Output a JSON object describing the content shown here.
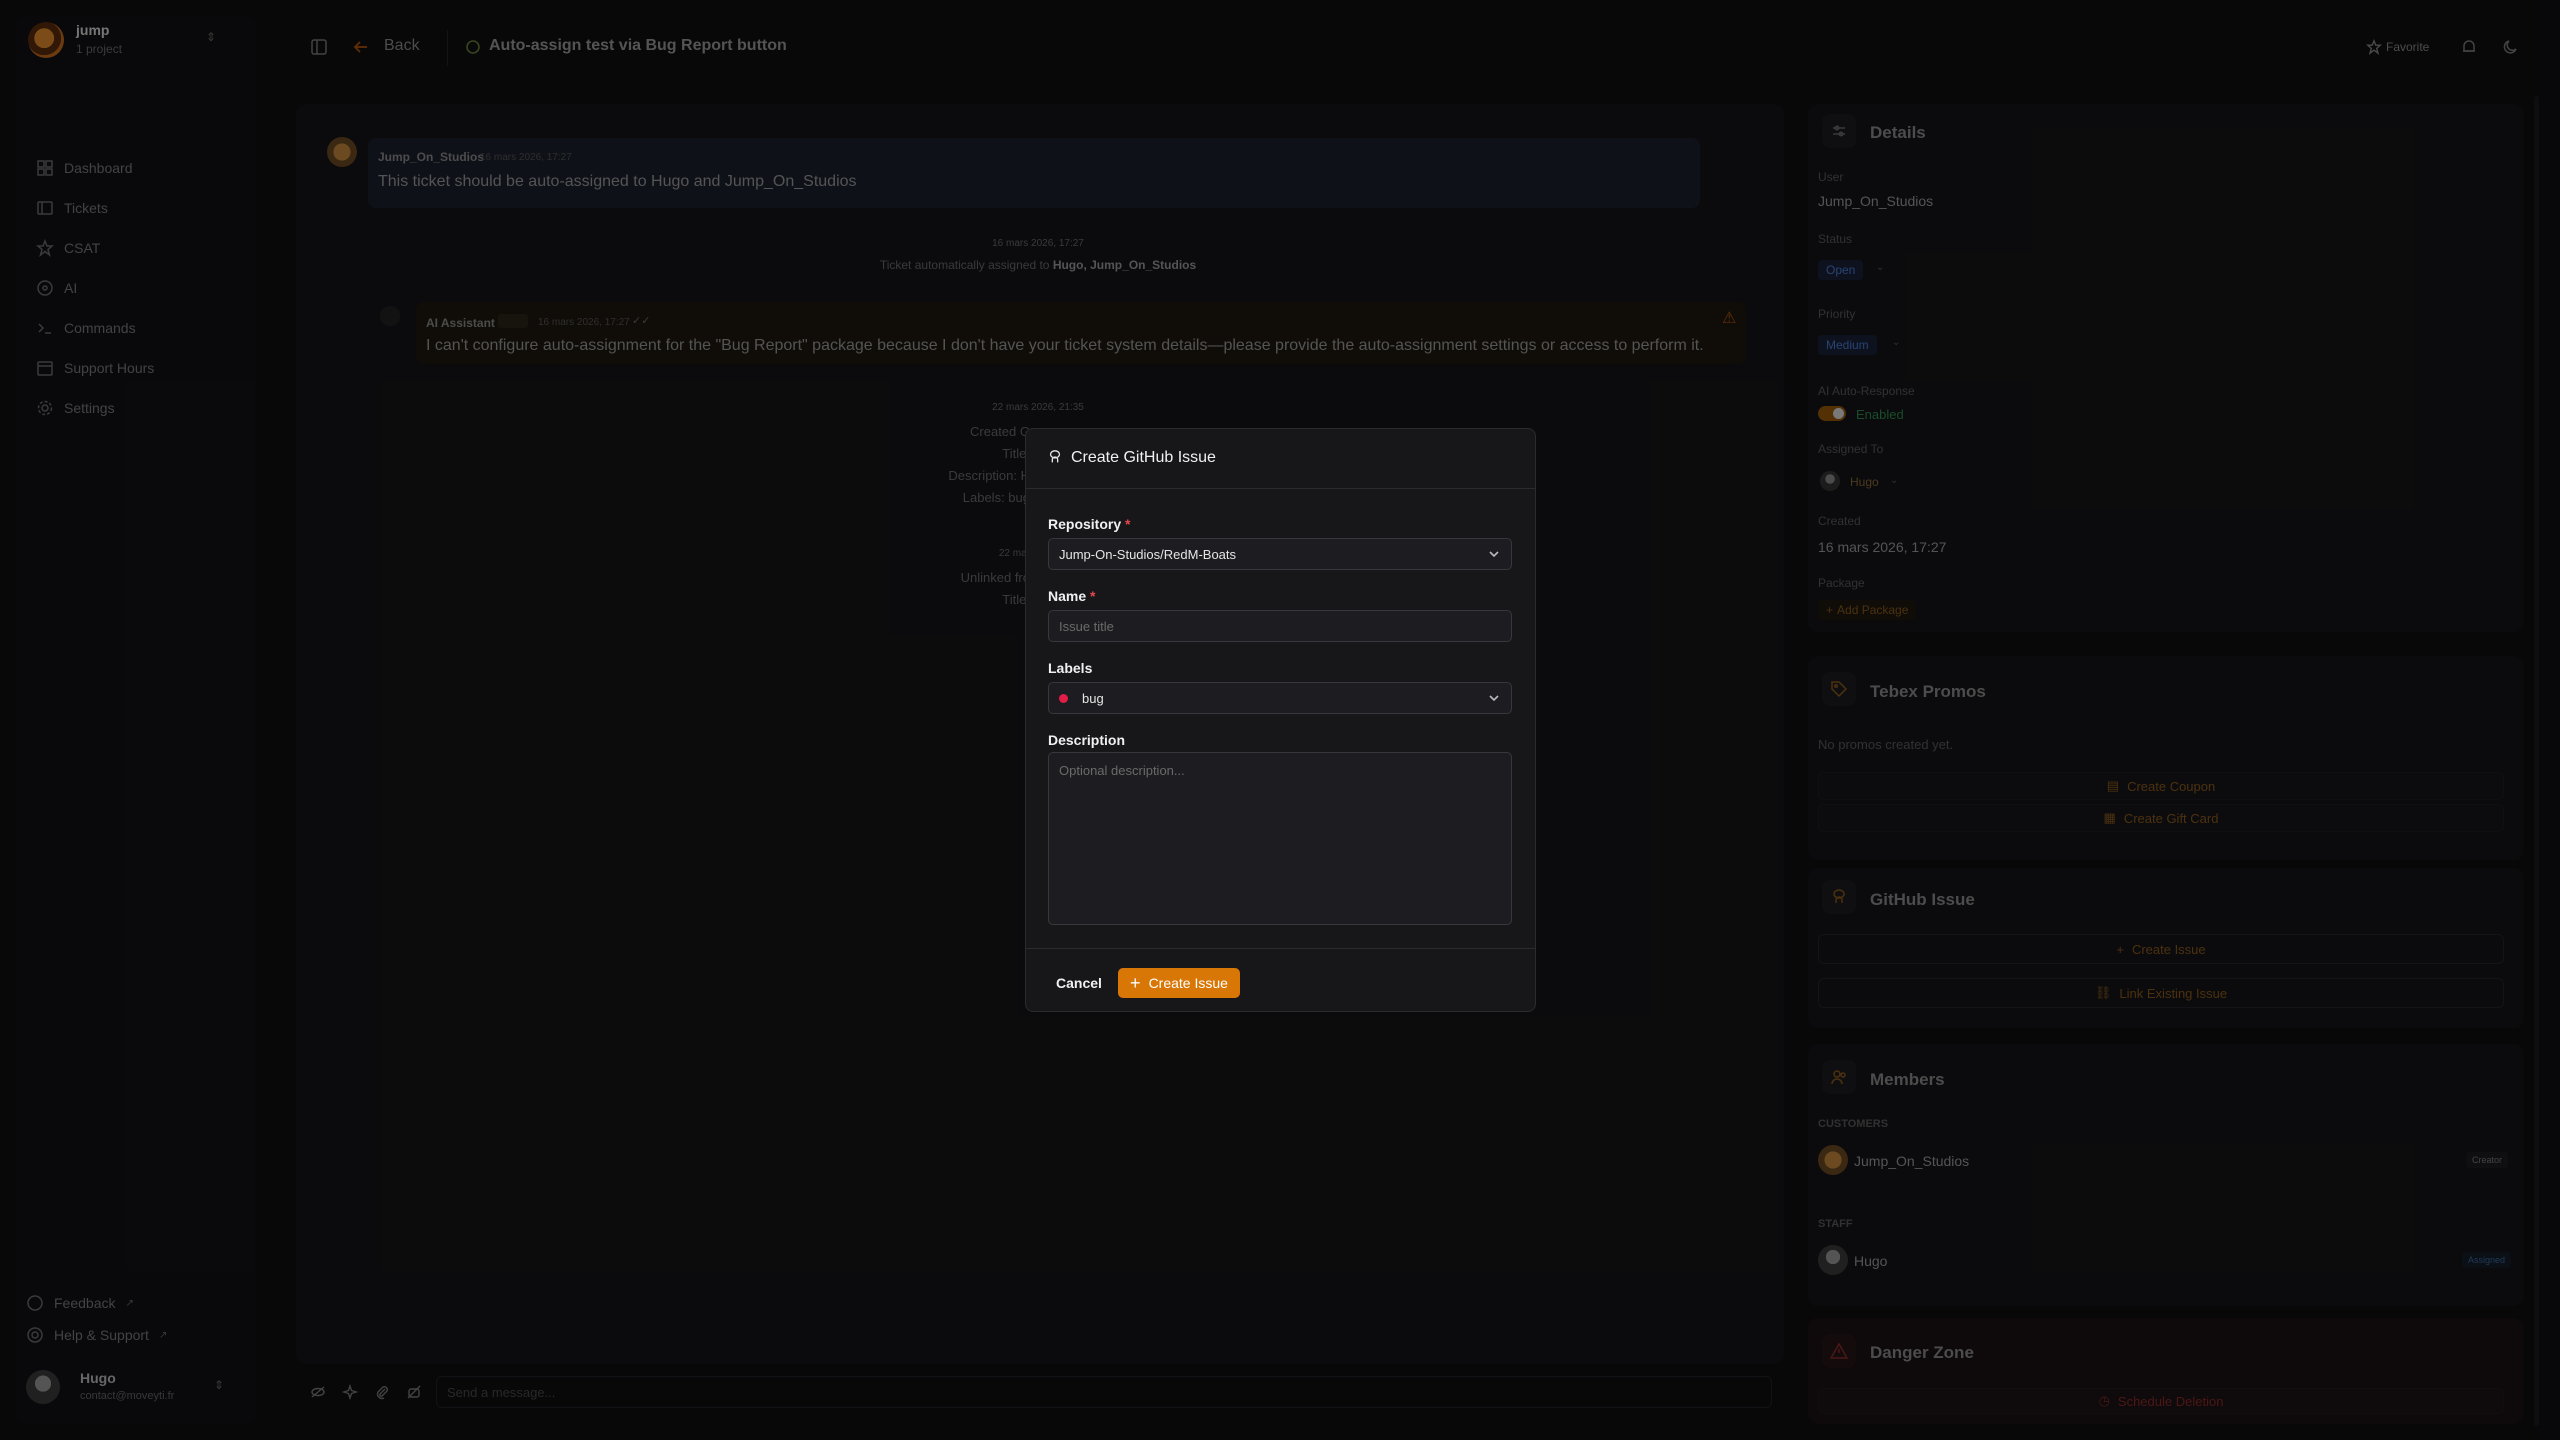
{
  "workspace": {
    "name": "jump",
    "subtitle": "1 project"
  },
  "nav": {
    "items": [
      {
        "label": "Dashboard"
      },
      {
        "label": "Tickets"
      },
      {
        "label": "CSAT"
      },
      {
        "label": "AI"
      },
      {
        "label": "Commands"
      },
      {
        "label": "Support Hours"
      },
      {
        "label": "Settings"
      }
    ]
  },
  "sidebar_footer": {
    "feedback": "Feedback",
    "help": "Help & Support",
    "user_name": "Hugo",
    "user_email": "contact@moveyti.fr"
  },
  "topbar": {
    "back": "Back",
    "ticket_title": "Auto-assign test via Bug Report button",
    "favorite": "Favorite"
  },
  "chat": {
    "msg1": {
      "author": "Jump_On_Studios",
      "time": "16 mars 2026, 17:27",
      "text": "This ticket should be auto-assigned to Hugo and Jump_On_Studios"
    },
    "event1": {
      "time": "16 mars 2026, 17:27",
      "text": "Ticket automatically assigned to",
      "names": "Hugo, Jump_On_Studios"
    },
    "ai": {
      "author": "AI Assistant",
      "time": "16 mars 2026, 17:27",
      "text": "I can't configure auto-assignment for the \"Bug Report\" package because I don't have your ticket system details—please provide the auto-assignment settings or access to perform it."
    },
    "event2": {
      "time": "22 mars 2026, 21:35",
      "l1": "Created G",
      "l2": "Title:",
      "l3": "Description: H",
      "l4": "Labels: bug"
    },
    "event3": {
      "time": "22 mar",
      "l1": "Unlinked fro",
      "l2": "Title:"
    },
    "composer_placeholder": "Send a message..."
  },
  "details": {
    "title": "Details",
    "user_label": "User",
    "user_value": "Jump_On_Studios",
    "status_label": "Status",
    "status_value": "Open",
    "priority_label": "Priority",
    "priority_value": "Medium",
    "ai_label": "AI Auto-Response",
    "ai_value": "Enabled",
    "assigned_label": "Assigned To",
    "assigned_value": "Hugo",
    "created_label": "Created",
    "created_value": "16 mars 2026, 17:27",
    "package_label": "Package",
    "package_add": "Add Package"
  },
  "tebex": {
    "title": "Tebex Promos",
    "empty": "No promos created yet.",
    "coupon": "Create Coupon",
    "giftcard": "Create Gift Card"
  },
  "github": {
    "title": "GitHub Issue",
    "create": "Create Issue",
    "link": "Link Existing Issue"
  },
  "members": {
    "title": "Members",
    "customers_label": "CUSTOMERS",
    "customer_name": "Jump_On_Studios",
    "customer_badge": "Creator",
    "staff_label": "STAFF",
    "staff_name": "Hugo",
    "staff_badge": "Assigned"
  },
  "danger": {
    "title": "Danger Zone",
    "action": "Schedule Deletion"
  },
  "modal": {
    "title": "Create GitHub Issue",
    "repository_label": "Repository",
    "repository_value": "Jump-On-Studios/RedM-Boats",
    "name_label": "Name",
    "name_placeholder": "Issue title",
    "labels_label": "Labels",
    "labels_value": "bug",
    "description_label": "Description",
    "description_placeholder": "Optional description...",
    "cancel": "Cancel",
    "create": "Create Issue",
    "required_mark": "*"
  },
  "colors": {
    "accent": "#d97706",
    "bug_label": "#e11d48",
    "required": "#e5484d",
    "status_open": "#3b82f6",
    "enabled": "#22c55e",
    "danger": "#ef4444"
  }
}
